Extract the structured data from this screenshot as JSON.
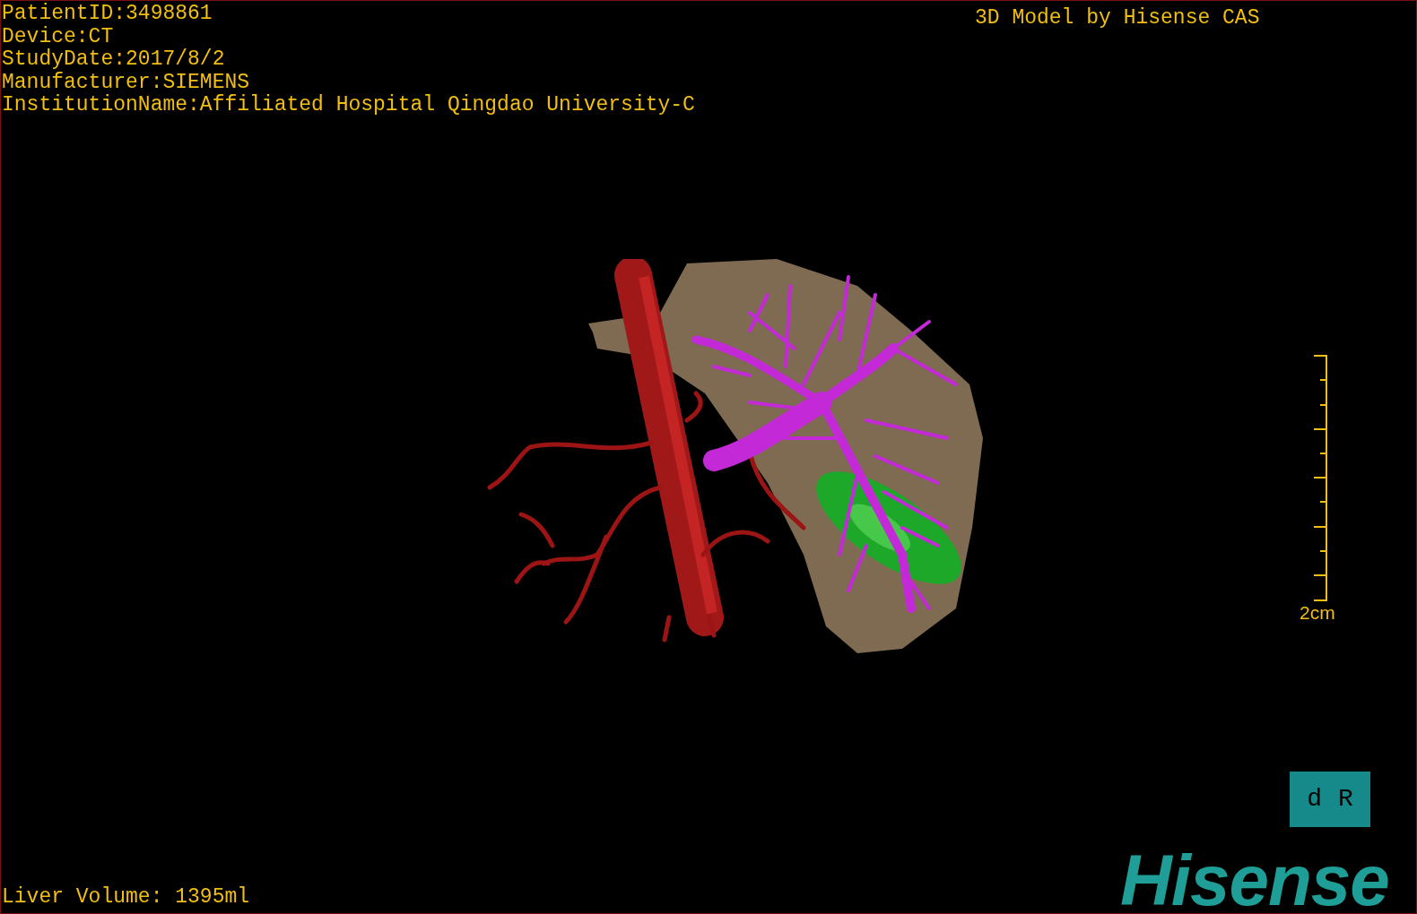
{
  "info_lines": [
    "PatientID:3498861",
    "Device:CT",
    "StudyDate:2017/8/2",
    "Manufacturer:SIEMENS",
    "InstitutionName:Affiliated Hospital Qingdao University-C"
  ],
  "model_title": "3D Model by Hisense CAS",
  "scale_bar": {
    "label": "2cm"
  },
  "orientation_cube": {
    "labels": [
      "d",
      "R"
    ]
  },
  "liver_volume": "Liver Volume: 1395ml",
  "logo": "Hisense"
}
